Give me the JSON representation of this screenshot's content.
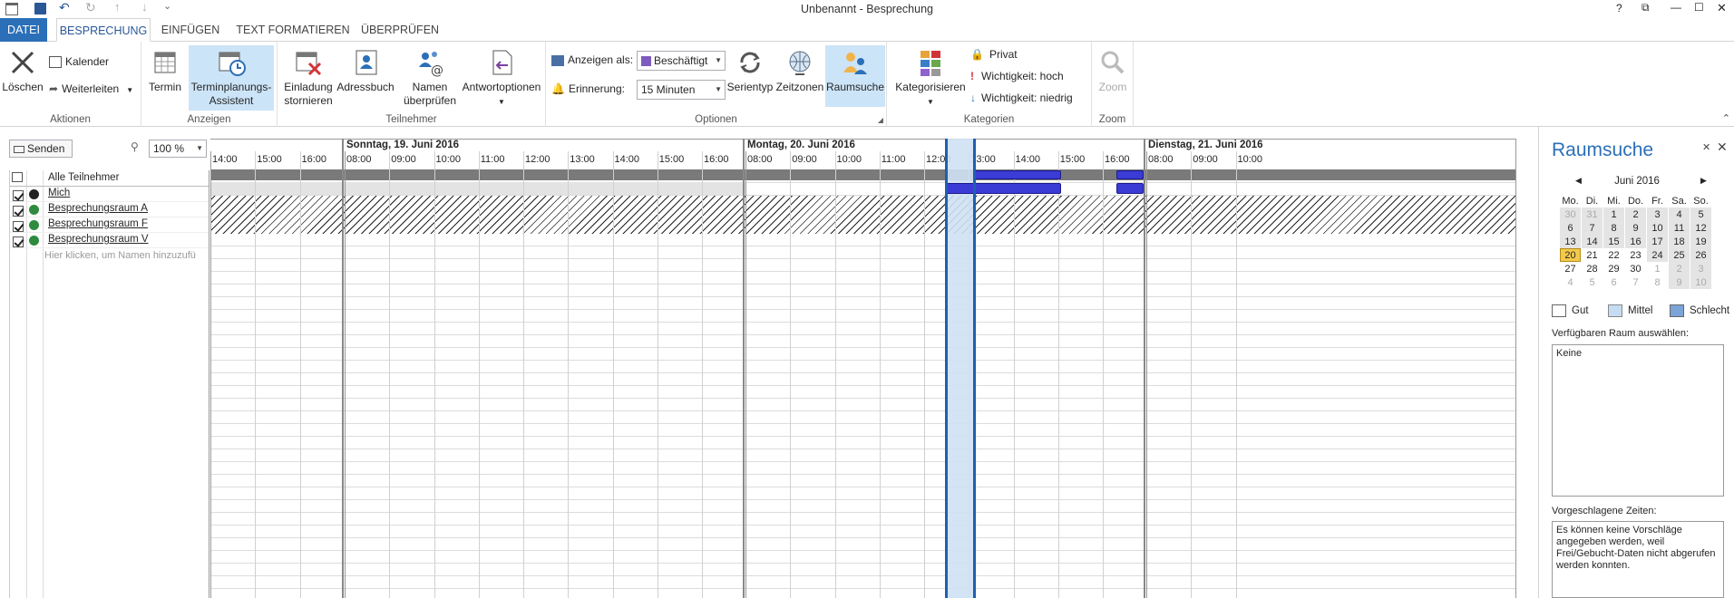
{
  "titlebar": {
    "title": "Unbenannt - Besprechung",
    "help": "?",
    "restore": "⧉",
    "minimize": "—",
    "maximize": "☐",
    "close": "✕"
  },
  "tabs": [
    "DATEI",
    "BESPRECHUNG",
    "EINFÜGEN",
    "TEXT FORMATIEREN",
    "ÜBERPRÜFEN"
  ],
  "ribbon": {
    "aktionen": {
      "label": "Aktionen",
      "loeschen": "Löschen",
      "kalender": "Kalender",
      "weiterleiten": "Weiterleiten"
    },
    "anzeigen": {
      "label": "Anzeigen",
      "termin": "Termin",
      "assistent1": "Terminplanungs-",
      "assistent2": "Assistent"
    },
    "teilnehmer": {
      "label": "Teilnehmer",
      "einladung1": "Einladung",
      "einladung2": "stornieren",
      "adressbuch": "Adressbuch",
      "namen1": "Namen",
      "namen2": "überprüfen",
      "antwort": "Antwortoptionen"
    },
    "optionen": {
      "label": "Optionen",
      "anzeigen_als": "Anzeigen als:",
      "anzeigen_value": "Beschäftigt",
      "erinnerung": "Erinnerung:",
      "erinnerung_value": "15 Minuten",
      "serientyp": "Serientyp",
      "zeitzonen": "Zeitzonen",
      "raumsuche": "Raumsuche"
    },
    "kategorien": {
      "label": "Kategorien",
      "kategorisieren": "Kategorisieren",
      "privat": "Privat",
      "hoch": "Wichtigkeit: hoch",
      "niedrig": "Wichtigkeit: niedrig"
    },
    "zoom": {
      "label": "Zoom",
      "zoom": "Zoom"
    }
  },
  "left": {
    "senden": "Senden",
    "zoom_value": "100 %",
    "alle": "Alle Teilnehmer",
    "attendees": [
      {
        "name": "Mich",
        "icon": "organizer-icon"
      },
      {
        "name": "Besprechungsraum A",
        "icon": "room-icon"
      },
      {
        "name": "Besprechungsraum F",
        "icon": "room-icon"
      },
      {
        "name": "Besprechungsraum V",
        "icon": "room-icon"
      }
    ],
    "add_placeholder": "Hier klicken, um Namen hinzuzufü"
  },
  "schedule": {
    "days": [
      "Sonntag, 19. Juni 2016",
      "Montag, 20. Juni 2016",
      "Dienstag, 21. Juni 2016"
    ],
    "hours": [
      [
        "14:00",
        "15:00",
        "16:00"
      ],
      [
        "08:00",
        "09:00",
        "10:00",
        "11:00",
        "12:00",
        "13:00",
        "14:00",
        "15:00",
        "16:00"
      ],
      [
        "08:00",
        "09:00",
        "10:00",
        "11:00",
        "12:00",
        "13:00",
        "14:00",
        "15:00",
        "16:00"
      ],
      [
        "08:00",
        "09:00",
        "10:00"
      ]
    ]
  },
  "side": {
    "title": "Raumsuche",
    "month": "Juni 2016",
    "weekdays": [
      "Mo.",
      "Di.",
      "Mi.",
      "Do.",
      "Fr.",
      "Sa.",
      "So."
    ],
    "weeks": [
      [
        "30",
        "31",
        "1",
        "2",
        "3",
        "4",
        "5"
      ],
      [
        "6",
        "7",
        "8",
        "9",
        "10",
        "11",
        "12"
      ],
      [
        "13",
        "14",
        "15",
        "16",
        "17",
        "18",
        "19"
      ],
      [
        "20",
        "21",
        "22",
        "23",
        "24",
        "25",
        "26"
      ],
      [
        "27",
        "28",
        "29",
        "30",
        "1",
        "2",
        "3"
      ],
      [
        "4",
        "5",
        "6",
        "7",
        "8",
        "9",
        "10"
      ]
    ],
    "legend": {
      "gut": "Gut",
      "mittel": "Mittel",
      "schlecht": "Schlecht"
    },
    "raum_label": "Verfügbaren Raum auswählen:",
    "raum_value": "Keine",
    "zeiten_label": "Vorgeschlagene Zeiten:",
    "zeiten_text": "Es können keine Vorschläge angegeben werden, weil Frei/Gebucht-Daten nicht abgerufen werden konnten."
  },
  "colors": {
    "accent": "#2b6fb8",
    "busy": "#3b3bd6",
    "selection": "#cfe2f5",
    "selected_border": "#1f5fae",
    "calendar_today": "#f3c94a"
  }
}
